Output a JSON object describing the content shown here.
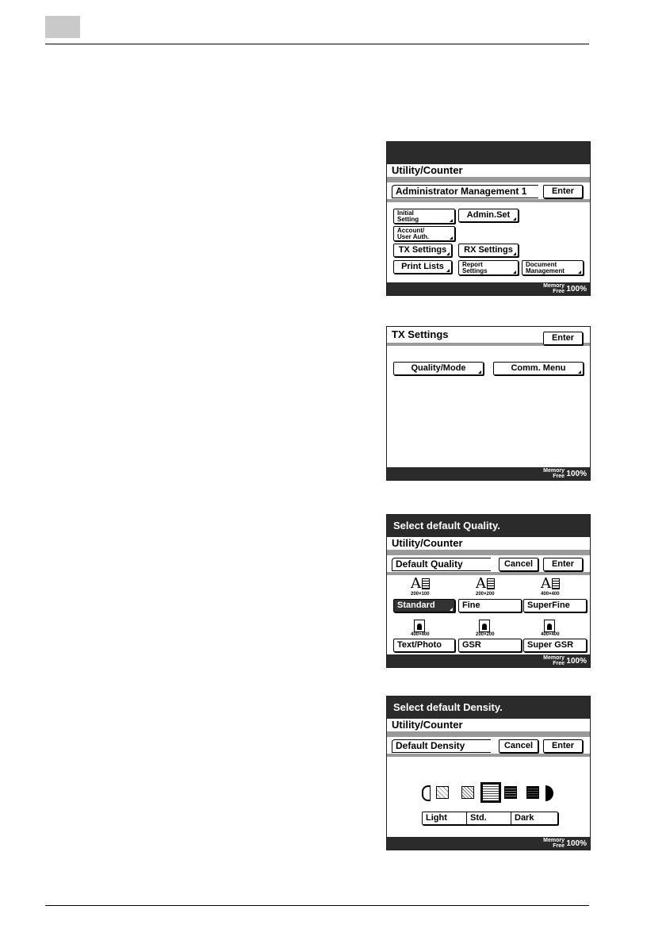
{
  "panel1": {
    "header": "Utility/Counter",
    "sub_title": "Administrator Management 1",
    "enter": "Enter",
    "buttons": {
      "initial_setting_1": "Initial",
      "initial_setting_2": "Setting",
      "admin_set": "Admin.Set",
      "account_1": "Account/",
      "account_2": "User Auth.",
      "tx_settings": "TX Settings",
      "rx_settings": "RX Settings",
      "print_lists": "Print Lists",
      "report_1": "Report",
      "report_2": "Settings",
      "document_1": "Document",
      "document_2": "Management"
    },
    "memory_1": "Memory",
    "memory_2": "Free",
    "memory_pct": "100%"
  },
  "panel2": {
    "header": "TX Settings",
    "enter": "Enter",
    "quality_mode": "Quality/Mode",
    "comm_menu": "Comm. Menu",
    "memory_1": "Memory",
    "memory_2": "Free",
    "memory_pct": "100%"
  },
  "panel3": {
    "title": "Select default Quality.",
    "header": "Utility/Counter",
    "sub_title": "Default Quality",
    "cancel": "Cancel",
    "enter": "Enter",
    "res_200x100": "200×100",
    "res_200x200": "200×200",
    "res_400x400": "400×400",
    "res_photo_400": "400×400",
    "res_photo_200": "200×200",
    "res_photo_400b": "400×400",
    "standard": "Standard",
    "fine": "Fine",
    "superfine": "SuperFine",
    "text_photo": "Text/Photo",
    "gsr": "GSR",
    "super_gsr": "Super GSR",
    "memory_1": "Memory",
    "memory_2": "Free",
    "memory_pct": "100%"
  },
  "panel4": {
    "title": "Select default Density.",
    "header": "Utility/Counter",
    "sub_title": "Default Density",
    "cancel": "Cancel",
    "enter": "Enter",
    "light": "Light",
    "std": "Std.",
    "dark": "Dark",
    "memory_1": "Memory",
    "memory_2": "Free",
    "memory_pct": "100%"
  }
}
